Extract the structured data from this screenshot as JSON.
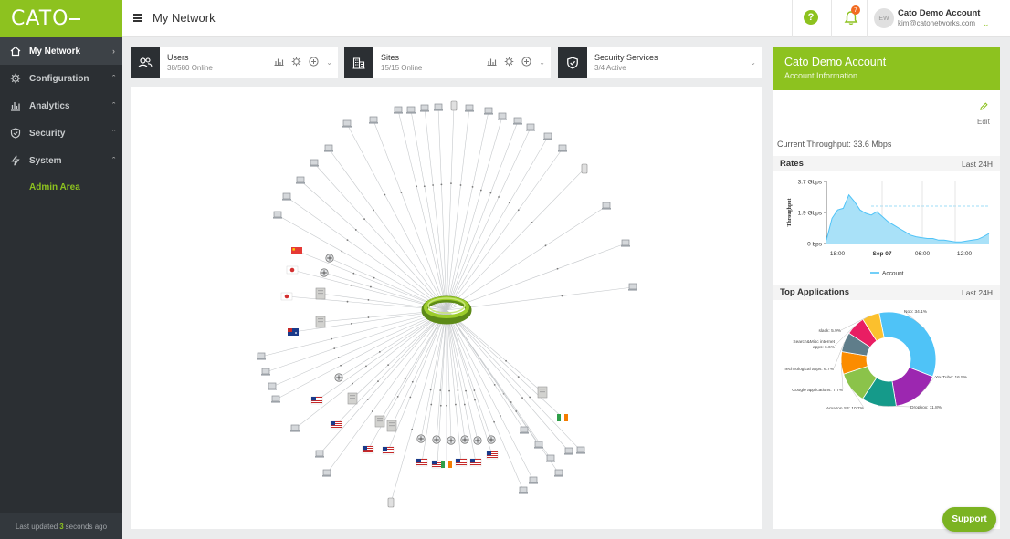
{
  "brand": {
    "logo_text": "CATO",
    "color": "#8dc21f"
  },
  "header": {
    "title": "My Network",
    "help_label": "?",
    "notification_count": "7"
  },
  "account": {
    "initials": "EW",
    "name": "Cato Demo Account",
    "email": "kim@catonetworks.com"
  },
  "sidebar": {
    "items": [
      {
        "label": "My Network",
        "icon": "home-icon",
        "active": true
      },
      {
        "label": "Configuration",
        "icon": "gear-icon"
      },
      {
        "label": "Analytics",
        "icon": "bar-chart-icon"
      },
      {
        "label": "Security",
        "icon": "shield-icon"
      },
      {
        "label": "System",
        "icon": "bolt-icon"
      }
    ],
    "admin_area": "Admin Area",
    "last_updated_prefix": "Last updated",
    "last_updated_value": "3",
    "last_updated_suffix": "seconds ago"
  },
  "stats": {
    "users": {
      "title": "Users",
      "sub": "38/580 Online"
    },
    "sites": {
      "title": "Sites",
      "sub": "15/15 Online"
    },
    "security": {
      "title": "Security Services",
      "sub": "3/4 Active"
    }
  },
  "right_panel": {
    "title": "Cato Demo Account",
    "subtitle": "Account Information",
    "edit_label": "Edit",
    "throughput": "Current Throughput: 33.6 Mbps",
    "rates_title": "Rates",
    "rates_range": "Last 24H",
    "apps_title": "Top Applications",
    "apps_range": "Last 24H"
  },
  "support_label": "Support",
  "chart_data": [
    {
      "type": "area",
      "title": "Rates",
      "ylabel": "Throughput",
      "y_ticks": [
        "0 bps",
        "1.9 Gbps",
        "3.7 Gbps"
      ],
      "x_ticks": [
        "18:00",
        "Sep 07",
        "06:00",
        "12:00"
      ],
      "series": [
        {
          "name": "Account",
          "color": "#4fc3f7",
          "values": [
            0.2,
            1.5,
            2.0,
            2.1,
            2.9,
            2.5,
            2.0,
            1.8,
            1.7,
            1.9,
            1.6,
            1.3,
            1.1,
            0.9,
            0.7,
            0.5,
            0.4,
            0.35,
            0.3,
            0.3,
            0.2,
            0.2,
            0.15,
            0.1,
            0.1,
            0.15,
            0.2,
            0.25,
            0.4,
            0.6
          ]
        }
      ],
      "ylim": [
        0,
        3.7
      ],
      "legend": "bottom"
    },
    {
      "type": "pie",
      "title": "Top Applications",
      "slices": [
        {
          "label": "Nop: 34.1%",
          "value": 34.1,
          "color": "#4fc3f7"
        },
        {
          "label": "YouTube: 16.5%",
          "value": 16.5,
          "color": "#9c27b0"
        },
        {
          "label": "Dropbox: 11.8%",
          "value": 11.8,
          "color": "#159a8a"
        },
        {
          "label": "Amazon S3: 10.7%",
          "value": 10.7,
          "color": "#8bc34a"
        },
        {
          "label": "Google applications: 7.7%",
          "value": 7.7,
          "color": "#fb8c00"
        },
        {
          "label": "Technological apps: 6.7%",
          "value": 6.7,
          "color": "#5f7d8a"
        },
        {
          "label": "Search&Misc internet apps: 6.6%",
          "value": 6.6,
          "color": "#e91e63"
        },
        {
          "label": "slack: 5.9%",
          "value": 5.9,
          "color": "#fbc02d"
        }
      ]
    }
  ]
}
